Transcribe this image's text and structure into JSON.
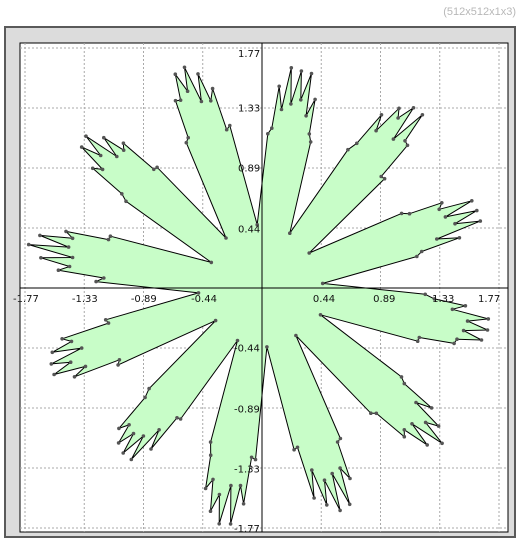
{
  "header": {
    "size_label": "(512x512x1x3)"
  },
  "plot": {
    "colors": {
      "fill": "#c8fdc8",
      "outline": "#000000",
      "point": "#555555",
      "grid": "#a9a9a9",
      "axis": "#000000",
      "panel": "#ffffff",
      "frame_bg": "#dcdcdc"
    },
    "x_ticks": [
      "-1.77",
      "-1.33",
      "-0.89",
      "-0.44",
      "0.44",
      "0.89",
      "1.33",
      "1.77"
    ],
    "y_ticks": [
      "1.77",
      "1.33",
      "0.89",
      "0.44",
      "-0.44",
      "-0.89",
      "-1.33",
      "-1.77"
    ]
  },
  "chart_data": {
    "type": "area",
    "title": "",
    "xlabel": "",
    "ylabel": "",
    "xlim": [
      -1.77,
      1.77
    ],
    "ylim": [
      -1.77,
      1.77
    ],
    "grid": true,
    "shape": "12-petal flower polygon",
    "petals": 12,
    "outer_radius_max": 1.77,
    "inner_radius": 0.44
  }
}
